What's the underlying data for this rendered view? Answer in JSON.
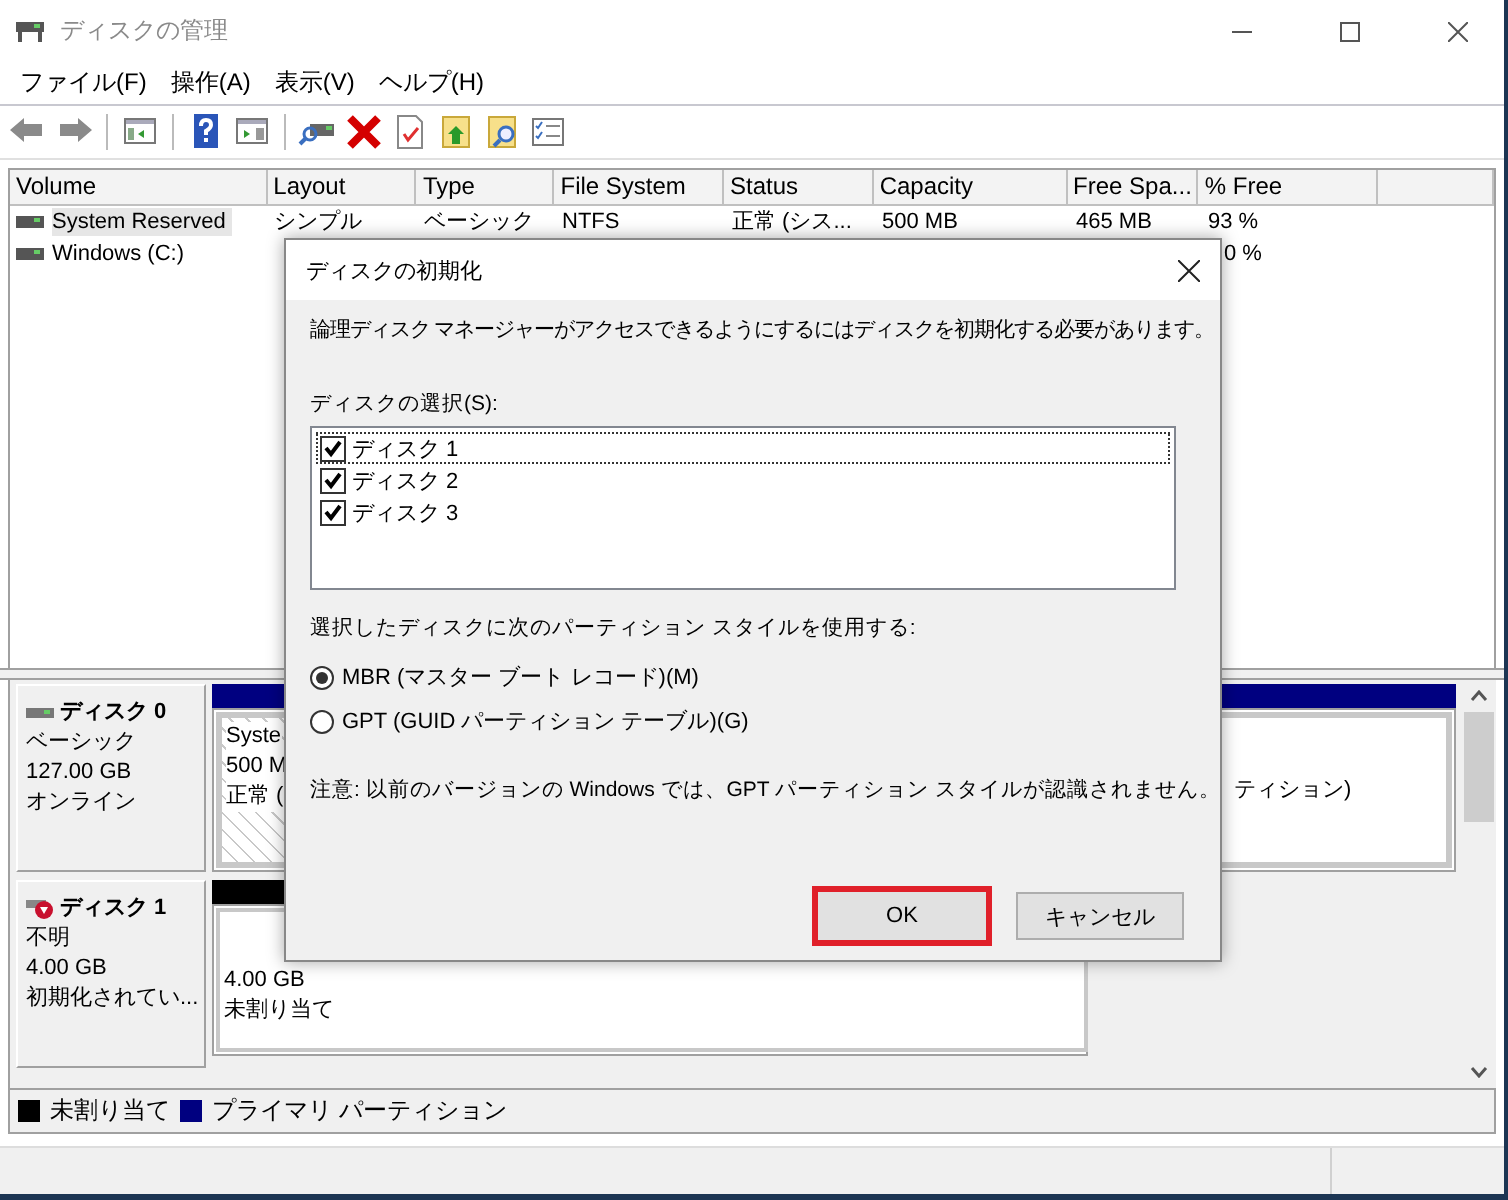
{
  "window": {
    "title": "ディスクの管理"
  },
  "menu": [
    "ファイル(F)",
    "操作(A)",
    "表示(V)",
    "ヘルプ(H)"
  ],
  "volumes": {
    "columns": [
      "Volume",
      "Layout",
      "Type",
      "File System",
      "Status",
      "Capacity",
      "Free Spa...",
      "% Free"
    ],
    "rows": [
      {
        "selected": true,
        "volume": "System Reserved",
        "layout": "シンプル",
        "type": "ベーシック",
        "file_system": "NTFS",
        "status": "正常 (シス...",
        "capacity": "500 MB",
        "free_space": "465 MB",
        "percent_free": "93 %"
      },
      {
        "selected": false,
        "volume": "Windows (C:)",
        "percent_free": "0 %"
      }
    ]
  },
  "disks": [
    {
      "kind": "online",
      "name": "ディスク 0",
      "type": "ベーシック",
      "size": "127.00 GB",
      "state": "オンライン",
      "color": "#000080",
      "partitions": [
        {
          "kind": "system",
          "lines": [
            "Syste",
            "500 M",
            "正常 ("
          ]
        },
        {
          "kind": "primary",
          "lines": [
            "ティション)"
          ]
        }
      ]
    },
    {
      "kind": "unknown",
      "name": "ディスク 1",
      "type": "不明",
      "size": "4.00 GB",
      "state": "初期化されてい...",
      "color": "#000000",
      "partitions": [
        {
          "kind": "unallocated",
          "lines": [
            "4.00 GB",
            "未割り当て"
          ]
        }
      ]
    }
  ],
  "legend": [
    {
      "label": "未割り当て",
      "color": "#000000"
    },
    {
      "label": "プライマリ パーティション",
      "color": "#000080"
    }
  ],
  "dialog": {
    "title": "ディスクの初期化",
    "message": "論理ディスク マネージャーがアクセスできるようにするにはディスクを初期化する必要があります。",
    "list_label": "ディスクの選択(S):",
    "disks": [
      {
        "label": "ディスク 1",
        "checked": true,
        "focused": true
      },
      {
        "label": "ディスク 2",
        "checked": true,
        "focused": false
      },
      {
        "label": "ディスク 3",
        "checked": true,
        "focused": false
      }
    ],
    "style_label": "選択したディスクに次のパーティション スタイルを使用する:",
    "options": [
      {
        "label": "MBR (マスター ブート レコード)(M)",
        "selected": true
      },
      {
        "label": "GPT (GUID パーティション テーブル)(G)",
        "selected": false
      }
    ],
    "note": "注意: 以前のバージョンの Windows では、GPT パーティション スタイルが認識されません。",
    "buttons": [
      {
        "label": "OK",
        "highlighted": true
      },
      {
        "label": "キャンセル",
        "highlighted": false
      }
    ]
  }
}
